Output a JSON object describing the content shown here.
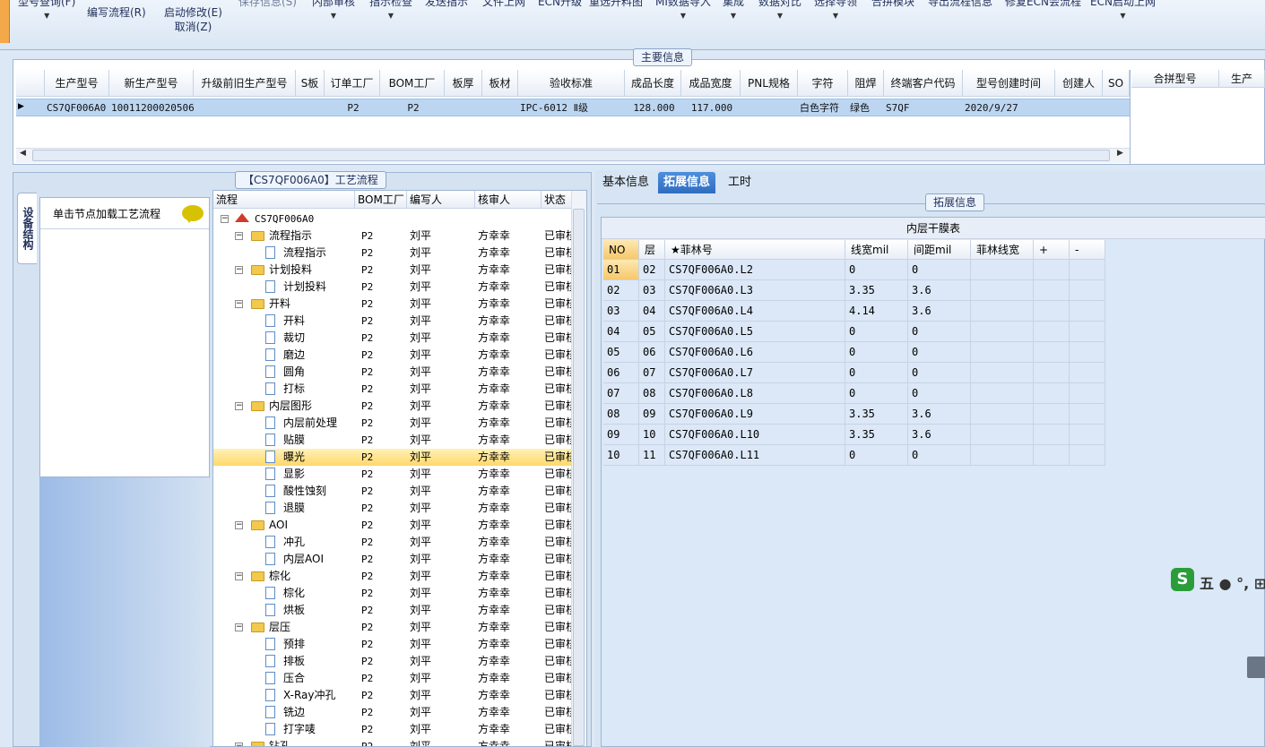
{
  "toolbar": {
    "items": [
      {
        "label": "型号查询(F)",
        "has_arrow": true
      },
      {
        "label": "编写流程(R)",
        "has_arrow": false
      },
      {
        "label": "启动修改(E)",
        "label2": "取消(Z)"
      },
      {
        "label": "保存信息(S)",
        "has_arrow": false
      },
      {
        "label": "内部审核",
        "has_arrow": true
      },
      {
        "label": "指示检查",
        "has_arrow": true
      },
      {
        "label": "发送指示",
        "has_arrow": false
      },
      {
        "label": "文件上网",
        "has_arrow": false
      },
      {
        "label": "ECN升级",
        "has_arrow": false
      },
      {
        "label": "重选开料图",
        "has_arrow": false
      },
      {
        "label": "MI数据导入",
        "has_arrow": true
      },
      {
        "label": "集成",
        "has_arrow": true
      },
      {
        "label": "数据对比",
        "has_arrow": true
      },
      {
        "label": "选择导领",
        "has_arrow": true
      },
      {
        "label": "合拼模块",
        "has_arrow": false
      },
      {
        "label": "导出流程信息",
        "has_arrow": false
      },
      {
        "label": "修复ECN会流程",
        "has_arrow": false
      },
      {
        "label": "ECN启动上网",
        "has_arrow": true
      }
    ]
  },
  "main_info": {
    "group_label": "主要信息",
    "columns": [
      "生产型号",
      "新生产型号",
      "升级前旧生产型号",
      "S板",
      "订单工厂",
      "BOM工厂",
      "板厚",
      "板材",
      "验收标准",
      "成品长度",
      "成品宽度",
      "PNL规格",
      "字符",
      "阻焊",
      "终端客户代码",
      "型号创建时间",
      "创建人",
      "SO"
    ],
    "row": [
      "CS7QF006A0",
      "10011200020506",
      "",
      "",
      "P2",
      "P2",
      "",
      "",
      "IPC-6012 Ⅱ级",
      "128.000",
      "117.000",
      "",
      "白色字符",
      "绿色",
      "S7QF",
      "2020/9/27",
      "",
      ""
    ],
    "merge_columns": [
      "合拼型号",
      "生产"
    ]
  },
  "process": {
    "group_label": "【CS7QF006A0】工艺流程",
    "vtab_label": "设备结构",
    "equipment_hint": "单击节点加载工艺流程",
    "columns": [
      "流程",
      "BOM工厂",
      "编写人",
      "核审人",
      "状态"
    ],
    "root": "CS7QF006A0",
    "rows": [
      {
        "name": "流程指示",
        "level": 1,
        "type": "folder",
        "bom": "P2",
        "writer": "刘平",
        "reviewer": "方幸幸",
        "status": "已审核"
      },
      {
        "name": "流程指示",
        "level": 2,
        "type": "page",
        "bom": "P2",
        "writer": "刘平",
        "reviewer": "方幸幸",
        "status": "已审核"
      },
      {
        "name": "计划投料",
        "level": 1,
        "type": "folder",
        "bom": "P2",
        "writer": "刘平",
        "reviewer": "方幸幸",
        "status": "已审核"
      },
      {
        "name": "计划投料",
        "level": 2,
        "type": "page",
        "bom": "P2",
        "writer": "刘平",
        "reviewer": "方幸幸",
        "status": "已审核"
      },
      {
        "name": "开料",
        "level": 1,
        "type": "folder",
        "bom": "P2",
        "writer": "刘平",
        "reviewer": "方幸幸",
        "status": "已审核"
      },
      {
        "name": "开料",
        "level": 2,
        "type": "page",
        "bom": "P2",
        "writer": "刘平",
        "reviewer": "方幸幸",
        "status": "已审核"
      },
      {
        "name": "裁切",
        "level": 2,
        "type": "page",
        "bom": "P2",
        "writer": "刘平",
        "reviewer": "方幸幸",
        "status": "已审核"
      },
      {
        "name": "磨边",
        "level": 2,
        "type": "page",
        "bom": "P2",
        "writer": "刘平",
        "reviewer": "方幸幸",
        "status": "已审核"
      },
      {
        "name": "圆角",
        "level": 2,
        "type": "page",
        "bom": "P2",
        "writer": "刘平",
        "reviewer": "方幸幸",
        "status": "已审核"
      },
      {
        "name": "打标",
        "level": 2,
        "type": "page",
        "bom": "P2",
        "writer": "刘平",
        "reviewer": "方幸幸",
        "status": "已审核"
      },
      {
        "name": "内层图形",
        "level": 1,
        "type": "folder",
        "bom": "P2",
        "writer": "刘平",
        "reviewer": "方幸幸",
        "status": "已审核"
      },
      {
        "name": "内层前处理",
        "level": 2,
        "type": "page",
        "bom": "P2",
        "writer": "刘平",
        "reviewer": "方幸幸",
        "status": "已审核"
      },
      {
        "name": "贴膜",
        "level": 2,
        "type": "page",
        "bom": "P2",
        "writer": "刘平",
        "reviewer": "方幸幸",
        "status": "已审核"
      },
      {
        "name": "曝光",
        "level": 2,
        "type": "page",
        "bom": "P2",
        "writer": "刘平",
        "reviewer": "方幸幸",
        "status": "已审核",
        "selected": true
      },
      {
        "name": "显影",
        "level": 2,
        "type": "page",
        "bom": "P2",
        "writer": "刘平",
        "reviewer": "方幸幸",
        "status": "已审核"
      },
      {
        "name": "酸性蚀刻",
        "level": 2,
        "type": "page",
        "bom": "P2",
        "writer": "刘平",
        "reviewer": "方幸幸",
        "status": "已审核"
      },
      {
        "name": "退膜",
        "level": 2,
        "type": "page",
        "bom": "P2",
        "writer": "刘平",
        "reviewer": "方幸幸",
        "status": "已审核"
      },
      {
        "name": "AOI",
        "level": 1,
        "type": "folder",
        "bom": "P2",
        "writer": "刘平",
        "reviewer": "方幸幸",
        "status": "已审核"
      },
      {
        "name": "冲孔",
        "level": 2,
        "type": "page",
        "bom": "P2",
        "writer": "刘平",
        "reviewer": "方幸幸",
        "status": "已审核"
      },
      {
        "name": "内层AOI",
        "level": 2,
        "type": "page",
        "bom": "P2",
        "writer": "刘平",
        "reviewer": "方幸幸",
        "status": "已审核"
      },
      {
        "name": "棕化",
        "level": 1,
        "type": "folder",
        "bom": "P2",
        "writer": "刘平",
        "reviewer": "方幸幸",
        "status": "已审核"
      },
      {
        "name": "棕化",
        "level": 2,
        "type": "page",
        "bom": "P2",
        "writer": "刘平",
        "reviewer": "方幸幸",
        "status": "已审核"
      },
      {
        "name": "烘板",
        "level": 2,
        "type": "page",
        "bom": "P2",
        "writer": "刘平",
        "reviewer": "方幸幸",
        "status": "已审核"
      },
      {
        "name": "层压",
        "level": 1,
        "type": "folder",
        "bom": "P2",
        "writer": "刘平",
        "reviewer": "方幸幸",
        "status": "已审核"
      },
      {
        "name": "预排",
        "level": 2,
        "type": "page",
        "bom": "P2",
        "writer": "刘平",
        "reviewer": "方幸幸",
        "status": "已审核"
      },
      {
        "name": "排板",
        "level": 2,
        "type": "page",
        "bom": "P2",
        "writer": "刘平",
        "reviewer": "方幸幸",
        "status": "已审核"
      },
      {
        "name": "压合",
        "level": 2,
        "type": "page",
        "bom": "P2",
        "writer": "刘平",
        "reviewer": "方幸幸",
        "status": "已审核"
      },
      {
        "name": "X-Ray冲孔",
        "level": 2,
        "type": "page",
        "bom": "P2",
        "writer": "刘平",
        "reviewer": "方幸幸",
        "status": "已审核"
      },
      {
        "name": "铣边",
        "level": 2,
        "type": "page",
        "bom": "P2",
        "writer": "刘平",
        "reviewer": "方幸幸",
        "status": "已审核"
      },
      {
        "name": "打字唛",
        "level": 2,
        "type": "page",
        "bom": "P2",
        "writer": "刘平",
        "reviewer": "方幸幸",
        "status": "已审核"
      },
      {
        "name": "钻孔",
        "level": 1,
        "type": "folder",
        "bom": "P2",
        "writer": "刘平",
        "reviewer": "方幸幸",
        "status": "已审核"
      }
    ]
  },
  "right_tabs": [
    "基本信息",
    "拓展信息",
    "工时"
  ],
  "active_tab": "拓展信息",
  "ext": {
    "group_label": "拓展信息",
    "table_title": "内层干膜表",
    "columns": [
      "NO",
      "层",
      "★菲林号",
      "线宽mil",
      "间距mil",
      "菲林线宽",
      "+",
      "-"
    ],
    "rows": [
      [
        "01",
        "02",
        "CS7QF006A0.L2",
        "0",
        "0"
      ],
      [
        "02",
        "03",
        "CS7QF006A0.L3",
        "3.35",
        "3.6"
      ],
      [
        "03",
        "04",
        "CS7QF006A0.L4",
        "4.14",
        "3.6"
      ],
      [
        "04",
        "05",
        "CS7QF006A0.L5",
        "0",
        "0"
      ],
      [
        "05",
        "06",
        "CS7QF006A0.L6",
        "0",
        "0"
      ],
      [
        "06",
        "07",
        "CS7QF006A0.L7",
        "0",
        "0"
      ],
      [
        "07",
        "08",
        "CS7QF006A0.L8",
        "0",
        "0"
      ],
      [
        "08",
        "09",
        "CS7QF006A0.L9",
        "3.35",
        "3.6"
      ],
      [
        "09",
        "10",
        "CS7QF006A0.L10",
        "3.35",
        "3.6"
      ],
      [
        "10",
        "11",
        "CS7QF006A0.L11",
        "0",
        "0"
      ]
    ]
  },
  "ime": {
    "logo": "S",
    "text": "五 ● °, ⊞"
  }
}
